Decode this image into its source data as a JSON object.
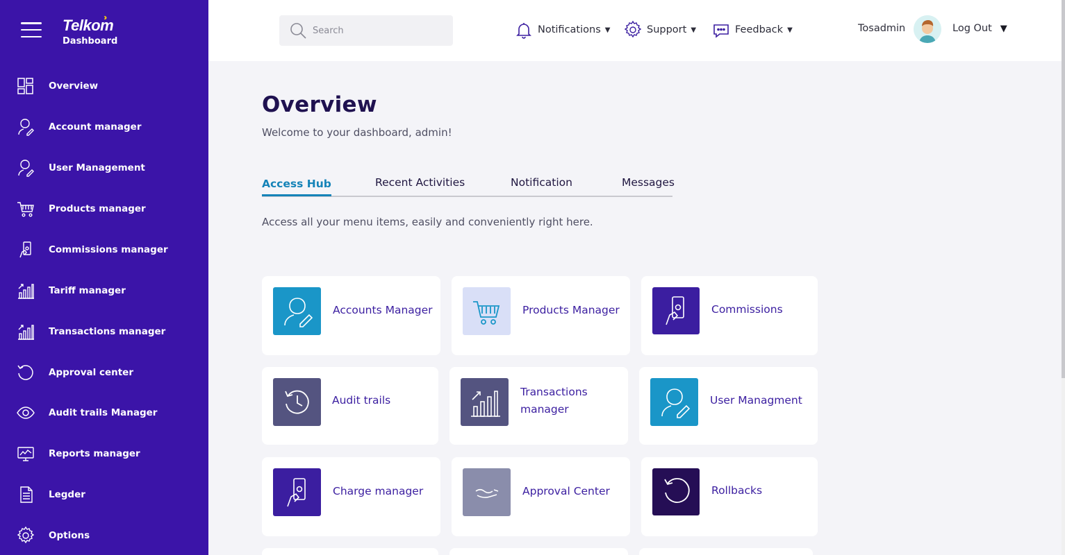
{
  "brand": {
    "name": "Telkom",
    "subtitle": "Dashboard"
  },
  "sidebar": {
    "items": [
      {
        "label": "Overview",
        "icon": "overview-grid-icon"
      },
      {
        "label": "Account manager",
        "icon": "person-pen-icon"
      },
      {
        "label": "User Management",
        "icon": "person-pen-icon"
      },
      {
        "label": "Products manager",
        "icon": "cart-icon"
      },
      {
        "label": "Commissions manager",
        "icon": "hand-cash-icon"
      },
      {
        "label": "Tariff manager",
        "icon": "bar-growth-icon"
      },
      {
        "label": "Transactions manager",
        "icon": "bar-growth-icon"
      },
      {
        "label": "Approval center",
        "icon": "refresh-circle-icon"
      },
      {
        "label": "Audit trails Manager",
        "icon": "eye-icon"
      },
      {
        "label": "Reports manager",
        "icon": "monitor-chart-icon"
      },
      {
        "label": "Legder",
        "icon": "document-icon"
      },
      {
        "label": "Options",
        "icon": "gear-icon"
      }
    ]
  },
  "header": {
    "search_placeholder": "Search",
    "notifications": "Notifications",
    "support": "Support",
    "feedback": "Feedback",
    "username": "Tosadmin",
    "logout": "Log Out"
  },
  "main": {
    "title": "Overview",
    "subtitle": "Welcome to your dashboard, admin!",
    "tabs": [
      {
        "label": "Access Hub",
        "active": true
      },
      {
        "label": "Recent Activities",
        "active": false
      },
      {
        "label": "Notification",
        "active": false
      },
      {
        "label": "Messages",
        "active": false
      }
    ],
    "hub_description": "Access all your menu items, easily and conveniently right here.",
    "cards": [
      {
        "label": "Accounts Manager",
        "icon": "person-pen-icon",
        "color": "#1a96c8"
      },
      {
        "label": "Products Manager",
        "icon": "cart-icon",
        "color": "#d9dff7"
      },
      {
        "label": "Commissions",
        "icon": "hand-cash-icon",
        "color": "#3b1ea0"
      },
      {
        "label": "Audit trails",
        "icon": "clock-history-icon",
        "color": "#545480"
      },
      {
        "label": "Transactions manager",
        "icon": "bar-growth-icon",
        "color": "#545480"
      },
      {
        "label": "User Managment",
        "icon": "person-pen-icon",
        "color": "#1a96c8"
      },
      {
        "label": "Charge manager",
        "icon": "hand-cash-icon",
        "color": "#3b1ea0"
      },
      {
        "label": "Approval Center",
        "icon": "hand-wave-icon",
        "color": "#8a8dab"
      },
      {
        "label": "Rollbacks",
        "icon": "rollback-icon",
        "color": "#250e55"
      }
    ]
  },
  "colors": {
    "sidebar_bg": "#3b14a8",
    "accent": "#1583b8",
    "title": "#1f1150",
    "card_text": "#3b1ea0",
    "page_bg": "#f4f4f8"
  }
}
